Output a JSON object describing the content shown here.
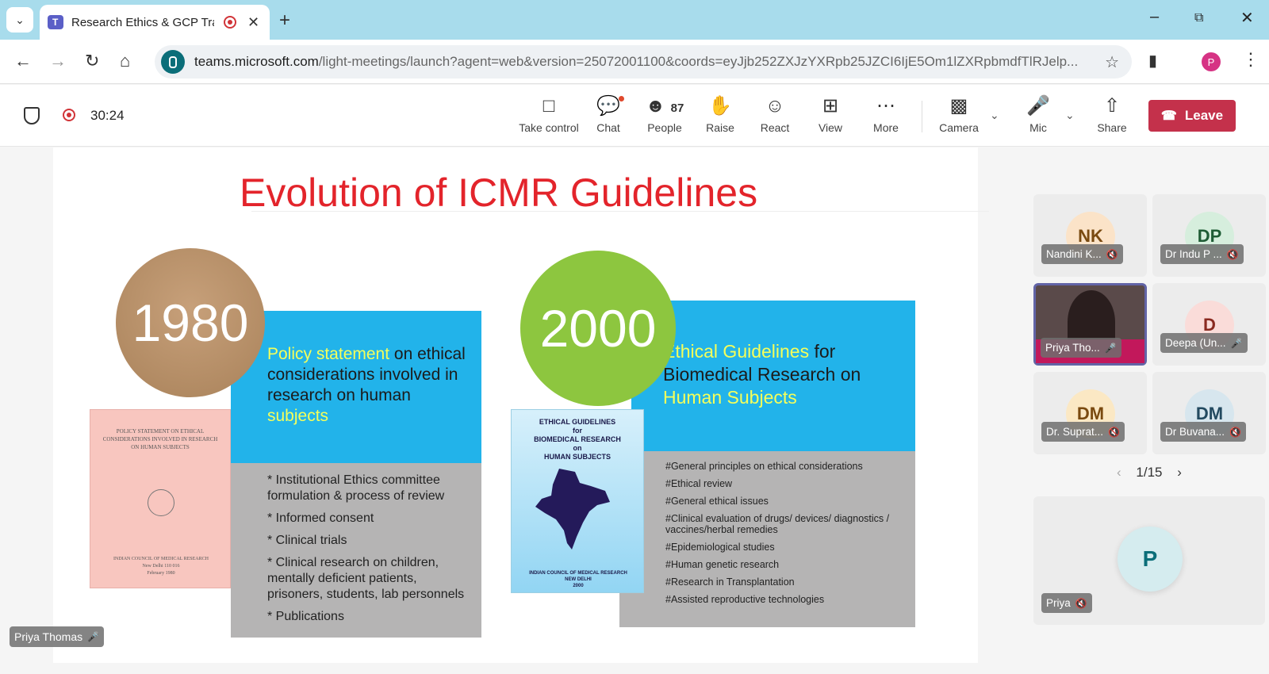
{
  "browser": {
    "tab_title": "Research Ethics & GCP Trair",
    "url_host": "teams.microsoft.com",
    "url_path": "/light-meetings/launch?agent=web&version=25072001100&coords=eyJjb252ZXJzYXRpb25JZCI6IjE5Om1lZXRpbmdfTlRJelp...",
    "profile_initial": "P"
  },
  "meeting": {
    "elapsed": "30:24",
    "toolbar": {
      "take_control": "Take control",
      "chat": "Chat",
      "people": "People",
      "people_count": "87",
      "raise": "Raise",
      "react": "React",
      "view": "View",
      "more": "More",
      "camera": "Camera",
      "mic": "Mic",
      "share": "Share",
      "leave": "Leave"
    },
    "accent_color": "#c4314b"
  },
  "slide": {
    "title": "Evolution of ICMR Guidelines",
    "left": {
      "year": "1980",
      "blue_hl1": "Policy statement",
      "blue_rest": " on ethical considerations involved in research on human ",
      "blue_hl2": "subjects",
      "items": [
        "* Institutional Ethics committee formulation & process of review",
        "* Informed consent",
        "* Clinical trials",
        "* Clinical research on children, mentally deficient patients, prisoners,  students, lab personnels",
        "* Publications"
      ],
      "book_title": "POLICY STATEMENT ON ETHICAL CONSIDERATIONS INVOLVED IN RESEARCH ON HUMAN SUBJECTS",
      "book_footer1": "INDIAN COUNCIL OF MEDICAL RESEARCH",
      "book_footer2": "New Delhi 110 016",
      "book_footer3": "February 1980"
    },
    "right": {
      "year": "2000",
      "blue_hl1": "Ethical Guidelines",
      "blue_rest": " for Biomedical Research on ",
      "blue_hl2": "Human Subjects",
      "items": [
        "#General principles on ethical considerations",
        "#Ethical review",
        "#General ethical issues",
        "#Clinical evaluation of drugs/ devices/ diagnostics / vaccines/herbal remedies",
        "#Epidemiological studies",
        "#Human genetic research",
        "#Research in Transplantation",
        "#Assisted reproductive technologies"
      ],
      "book_title1": "ETHICAL GUIDELINES",
      "book_title2": "for",
      "book_title3": "BIOMEDICAL RESEARCH",
      "book_title4": "on",
      "book_title5": "HUMAN SUBJECTS",
      "book_footer1": "INDIAN COUNCIL OF MEDICAL RESEARCH",
      "book_footer2": "NEW DELHI",
      "book_footer3": "2000"
    },
    "presenter_label": "Priya Thomas"
  },
  "participants": {
    "tiles": [
      {
        "initials": "NK",
        "name": "Nandini K...",
        "bg": "#fbe3c8",
        "fg": "#7a4a10"
      },
      {
        "initials": "DP",
        "name": "Dr Indu P ...",
        "bg": "#d6eedd",
        "fg": "#1f5c35"
      },
      {
        "initials": "",
        "name": "Priya Tho...",
        "bg": "#5a4a4a",
        "fg": "#ffffff"
      },
      {
        "initials": "D",
        "name": "Deepa (Un...",
        "bg": "#fadcd9",
        "fg": "#8a2a20"
      },
      {
        "initials": "DM",
        "name": "Dr. Suprat...",
        "bg": "#fbe8c4",
        "fg": "#7a4a10"
      },
      {
        "initials": "DM",
        "name": "Dr Buvana...",
        "bg": "#d7e6ee",
        "fg": "#234a60"
      }
    ],
    "pager": "1/15",
    "self": {
      "initials": "P",
      "name": "Priya"
    }
  }
}
